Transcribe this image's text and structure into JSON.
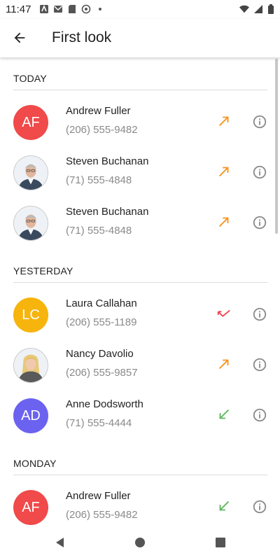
{
  "status_bar": {
    "time": "11:47",
    "icons": [
      "notification-icon",
      "gmail-icon",
      "sd-card-icon",
      "at-icon",
      "dot-icon",
      "wifi-icon",
      "signal-icon",
      "battery-icon"
    ]
  },
  "app_bar": {
    "title": "First look",
    "back_icon": "arrow-back-icon"
  },
  "sections": [
    {
      "title": "TODAY",
      "items": [
        {
          "name": "Andrew Fuller",
          "number": "(206) 555-9482",
          "avatar": "AF",
          "avatar_color": "#f04a4a",
          "call_type": "outgoing"
        },
        {
          "name": "Steven Buchanan",
          "number": "(71) 555-4848",
          "avatar_photo": "photo-avatar",
          "call_type": "outgoing"
        },
        {
          "name": "Steven Buchanan",
          "number": "(71) 555-4848",
          "avatar_photo": "photo-avatar",
          "call_type": "outgoing"
        }
      ]
    },
    {
      "title": "YESTERDAY",
      "items": [
        {
          "name": "Laura Callahan",
          "number": "(206) 555-1189",
          "avatar": "LC",
          "avatar_color": "#f6b40d",
          "call_type": "missed"
        },
        {
          "name": "Nancy Davolio",
          "number": "(206) 555-9857",
          "avatar_photo": "photo-avatar",
          "call_type": "outgoing"
        },
        {
          "name": "Anne Dodsworth",
          "number": "(71) 555-4444",
          "avatar": "AD",
          "avatar_color": "#6c62f0",
          "call_type": "incoming"
        }
      ]
    },
    {
      "title": "MONDAY",
      "items": [
        {
          "name": "Andrew Fuller",
          "number": "(206) 555-9482",
          "avatar": "AF",
          "avatar_color": "#f04a4a",
          "call_type": "incoming"
        }
      ]
    }
  ],
  "colors": {
    "outgoing": "#f7931e",
    "missed": "#f0414e",
    "incoming": "#5cb85c",
    "info_icon": "#8a8a8a"
  },
  "nav_bar": {
    "back": "nav-back-icon",
    "home": "nav-home-icon",
    "recents": "nav-recents-icon"
  }
}
